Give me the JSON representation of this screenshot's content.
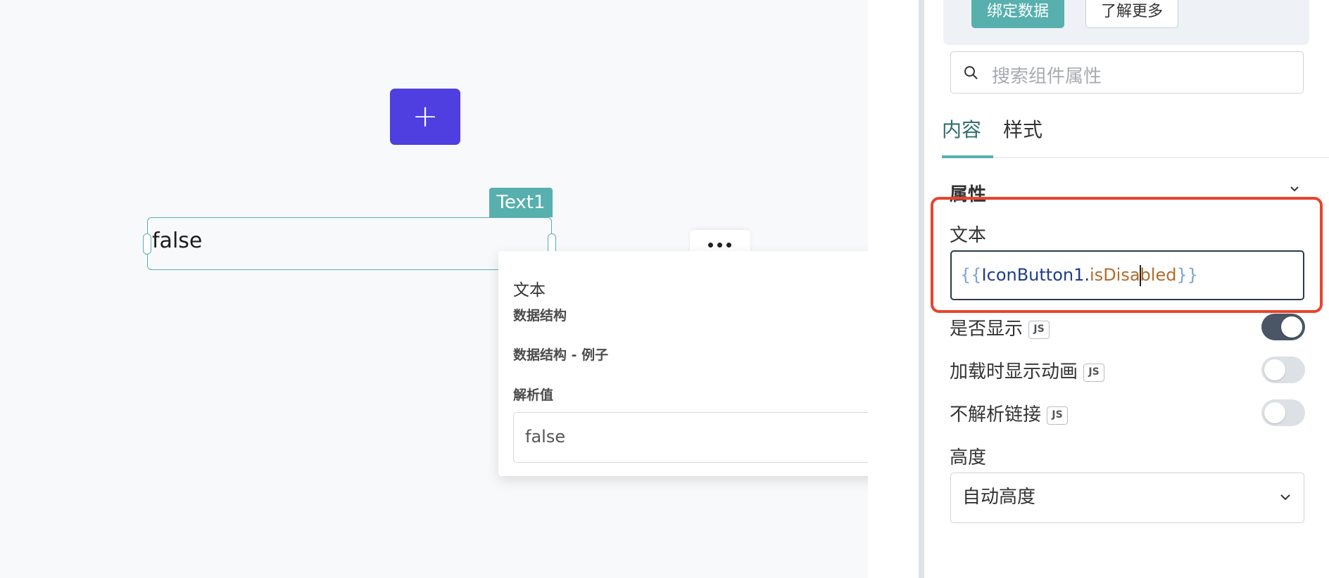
{
  "canvas": {
    "add_button_symbol": "+",
    "widget": {
      "name": "Text1",
      "value": "false"
    }
  },
  "popover": {
    "title": "文本",
    "rows": [
      {
        "label": "数据结构",
        "chevron": "›"
      },
      {
        "label": "数据结构 - 例子",
        "chevron": "›"
      },
      {
        "label": "解析值",
        "chevron": "⌄"
      }
    ],
    "evaluated_value": "false"
  },
  "panel": {
    "bind_data_label": "绑定数据",
    "learn_more_label": "了解更多",
    "search_placeholder": "搜索组件属性",
    "tabs": [
      {
        "label": "内容",
        "active": true
      },
      {
        "label": "样式",
        "active": false
      }
    ],
    "section_title": "属性",
    "text_field": {
      "label": "文本",
      "value_parts": {
        "open": "{{",
        "object": "IconButton1",
        "dot": ".",
        "prop_before_caret": "isDisa",
        "prop_after_caret": "bled",
        "close": "}}"
      }
    },
    "toggles": [
      {
        "label": "是否显示",
        "js": "JS",
        "on": true
      },
      {
        "label": "加载时显示动画",
        "js": "JS",
        "on": false
      },
      {
        "label": "不解析链接",
        "js": "JS",
        "on": false
      }
    ],
    "height": {
      "label": "高度",
      "value": "自动高度"
    }
  },
  "colors": {
    "accent": "#57b0ad",
    "primary_button": "#4f3ee0",
    "highlight": "#e8442d"
  }
}
